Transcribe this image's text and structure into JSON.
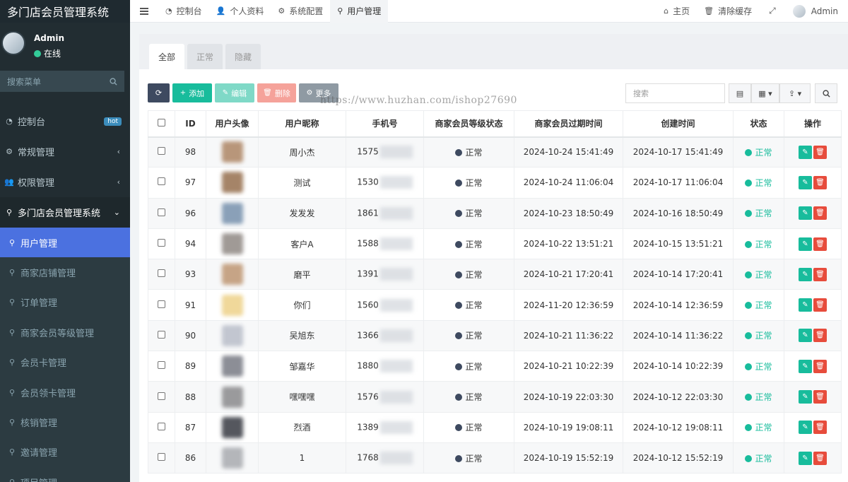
{
  "app": {
    "title": "多门店会员管理系统"
  },
  "user": {
    "name": "Admin",
    "status": "在线"
  },
  "sidebar": {
    "search_placeholder": "搜索菜单",
    "items": [
      {
        "label": "控制台",
        "icon": "dashboard-icon",
        "badge": "hot"
      },
      {
        "label": "常规管理",
        "icon": "cogs-icon",
        "arrow": "‹"
      },
      {
        "label": "权限管理",
        "icon": "group-icon",
        "arrow": "‹"
      },
      {
        "label": "多门店会员管理系统",
        "icon": "map-marker-icon",
        "arrow": "⌄"
      }
    ],
    "subitems": [
      {
        "label": "用户管理",
        "active": true
      },
      {
        "label": "商家店铺管理"
      },
      {
        "label": "订单管理"
      },
      {
        "label": "商家会员等级管理"
      },
      {
        "label": "会员卡管理"
      },
      {
        "label": "会员领卡管理"
      },
      {
        "label": "核销管理"
      },
      {
        "label": "邀请管理"
      },
      {
        "label": "项目管理"
      }
    ]
  },
  "topnav": {
    "menu_icon": "bars-icon",
    "tabs": [
      {
        "label": "控制台",
        "icon": "dashboard-icon"
      },
      {
        "label": "个人资料",
        "icon": "user-icon"
      },
      {
        "label": "系统配置",
        "icon": "cog-icon"
      },
      {
        "label": "用户管理",
        "icon": "map-marker-icon",
        "active": true
      }
    ],
    "right": {
      "home": "主页",
      "clear_cache": "清除缓存",
      "admin": "Admin"
    }
  },
  "content_tabs": [
    "全部",
    "正常",
    "隐藏"
  ],
  "toolbar": {
    "add": "添加",
    "edit": "编辑",
    "delete": "删除",
    "more": "更多",
    "search_placeholder": "搜索"
  },
  "watermark": "https://www.huzhan.com/ishop27690",
  "table": {
    "headers": [
      "ID",
      "用户头像",
      "用户昵称",
      "手机号",
      "商家会员等级状态",
      "商家会员过期时间",
      "创建时间",
      "状态",
      "操作"
    ],
    "rows": [
      {
        "id": "98",
        "nickname": "周小杰",
        "phone": "1575",
        "level": "正常",
        "expire": "2024-10-24 15:41:49",
        "created": "2024-10-17 15:41:49",
        "status": "正常",
        "avatar_color": "#b8967a"
      },
      {
        "id": "97",
        "nickname": "测试",
        "phone": "1530",
        "level": "正常",
        "expire": "2024-10-24 11:06:04",
        "created": "2024-10-17 11:06:04",
        "status": "正常",
        "avatar_color": "#a58468"
      },
      {
        "id": "96",
        "nickname": "发发发",
        "phone": "1861",
        "level": "正常",
        "expire": "2024-10-23 18:50:49",
        "created": "2024-10-16 18:50:49",
        "status": "正常",
        "avatar_color": "#8aa0b8"
      },
      {
        "id": "94",
        "nickname": "客户A",
        "phone": "1588",
        "level": "正常",
        "expire": "2024-10-22 13:51:21",
        "created": "2024-10-15 13:51:21",
        "status": "正常",
        "avatar_color": "#a09a96"
      },
      {
        "id": "93",
        "nickname": "磨平",
        "phone": "1391",
        "level": "正常",
        "expire": "2024-10-21 17:20:41",
        "created": "2024-10-14 17:20:41",
        "status": "正常",
        "avatar_color": "#c6a486"
      },
      {
        "id": "91",
        "nickname": "你们",
        "phone": "1560",
        "level": "正常",
        "expire": "2024-11-20 12:36:59",
        "created": "2024-10-14 12:36:59",
        "status": "正常",
        "avatar_color": "#f0d89a"
      },
      {
        "id": "90",
        "nickname": "吴旭东",
        "phone": "1366",
        "level": "正常",
        "expire": "2024-10-21 11:36:22",
        "created": "2024-10-14 11:36:22",
        "status": "正常",
        "avatar_color": "#c2c6d0"
      },
      {
        "id": "89",
        "nickname": "邹嘉华",
        "phone": "1880",
        "level": "正常",
        "expire": "2024-10-21 10:22:39",
        "created": "2024-10-14 10:22:39",
        "status": "正常",
        "avatar_color": "#8c8e96"
      },
      {
        "id": "88",
        "nickname": "嘿嘿嘿",
        "phone": "1576",
        "level": "正常",
        "expire": "2024-10-19 22:03:30",
        "created": "2024-10-12 22:03:30",
        "status": "正常",
        "avatar_color": "#9a9a9c"
      },
      {
        "id": "87",
        "nickname": "烈酒",
        "phone": "1389",
        "level": "正常",
        "expire": "2024-10-19 19:08:11",
        "created": "2024-10-12 19:08:11",
        "status": "正常",
        "avatar_color": "#55575e"
      },
      {
        "id": "86",
        "nickname": "1",
        "phone": "1768",
        "level": "正常",
        "expire": "2024-10-19 15:52:19",
        "created": "2024-10-12 15:52:19",
        "status": "正常",
        "avatar_color": "#b4b6ba"
      }
    ]
  },
  "colors": {
    "sidebar_bg": "#222d32",
    "active_blue": "#4b71e0",
    "success": "#18bc9c",
    "danger": "#e74c3c",
    "dark": "#3e4a60"
  }
}
